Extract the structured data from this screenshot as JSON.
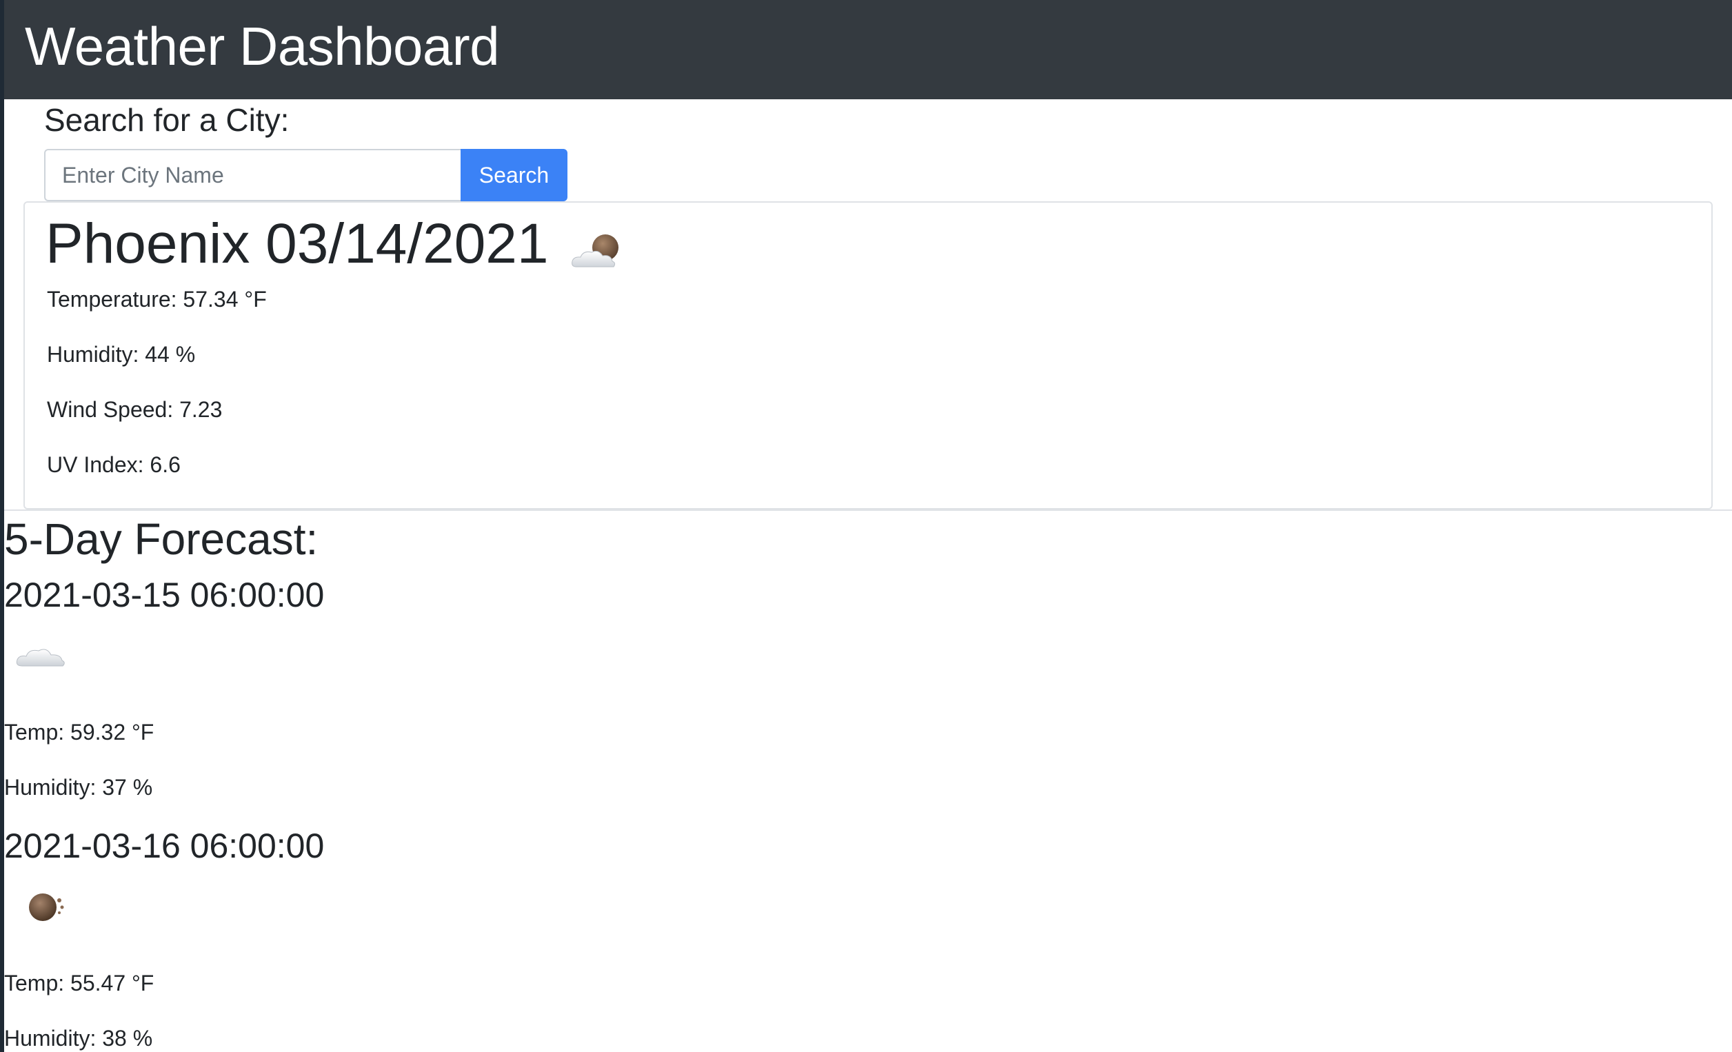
{
  "header": {
    "title": "Weather Dashboard"
  },
  "search": {
    "label": "Search for a City:",
    "placeholder": "Enter City Name",
    "value": "",
    "button_label": "Search"
  },
  "current": {
    "title": "Phoenix 03/14/2021",
    "icon": "partly-cloudy-night-icon",
    "temperature": "Temperature: 57.34 °F",
    "humidity": "Humidity: 44 %",
    "wind_speed": "Wind Speed: 7.23",
    "uv_index": "UV Index: 6.6"
  },
  "forecast": {
    "heading": "5-Day Forecast:",
    "days": [
      {
        "date": "2021-03-15 06:00:00",
        "icon": "cloud-icon",
        "temp": "Temp: 59.32 °F",
        "humidity": "Humidity: 37 %"
      },
      {
        "date": "2021-03-16 06:00:00",
        "icon": "moon-icon",
        "temp": "Temp: 55.47 °F",
        "humidity": "Humidity: 38 %"
      }
    ]
  },
  "colors": {
    "navbar": "#343a40",
    "accent": "#3b82f6",
    "text": "#212529"
  }
}
